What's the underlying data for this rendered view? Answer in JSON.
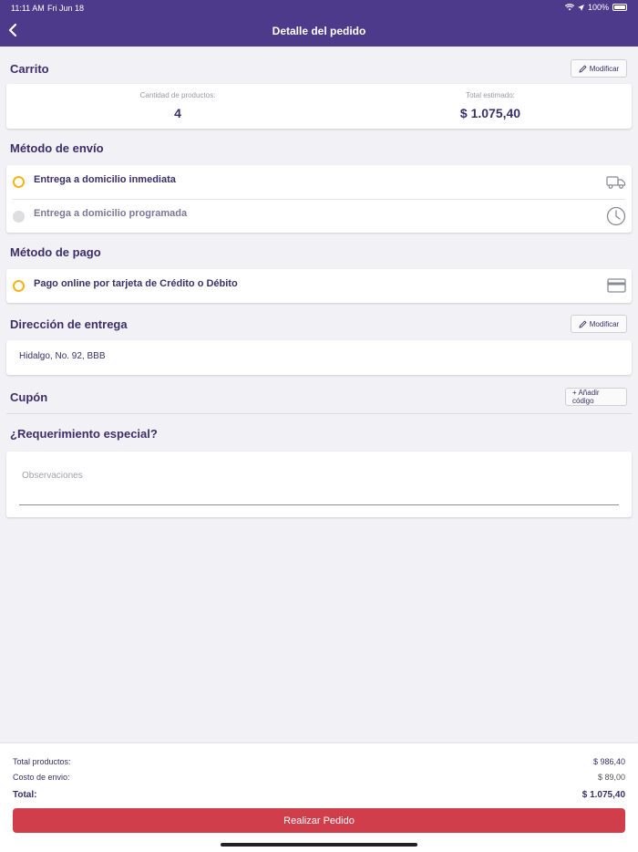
{
  "status": {
    "time": "11:11 AM",
    "date": "Fri Jun 18",
    "battery": "100%"
  },
  "header": {
    "title": "Detalle del pedido"
  },
  "cart": {
    "title": "Carrito",
    "modify_label": "Modificar",
    "qty_label": "Cantidad de productos:",
    "qty_value": "4",
    "total_label": "Total estimado:",
    "total_value": "$ 1.075,40"
  },
  "shipping": {
    "title": "Método de envío",
    "options": [
      {
        "label": "Entrega a domicilio inmediata",
        "selected": true,
        "icon": "truck-icon"
      },
      {
        "label": "Entrega a domicilio programada",
        "selected": false,
        "icon": "clock-icon"
      }
    ]
  },
  "payment": {
    "title": "Método de pago",
    "options": [
      {
        "label": "Pago online por tarjeta de Crédito o Débito",
        "selected": true,
        "icon": "credit-card-icon"
      }
    ]
  },
  "address": {
    "title": "Dirección de entrega",
    "modify_label": "Modificar",
    "value": "Hidalgo, No. 92, BBB"
  },
  "coupon": {
    "title": "Cupón",
    "add_label": "+ Añadir código"
  },
  "special": {
    "title": "¿Requerimiento especial?",
    "placeholder": "Observaciones"
  },
  "summary": {
    "products_label": "Total productos:",
    "products_value": "$ 986,40",
    "shipping_label": "Costo de envio:",
    "shipping_value": "$ 89,00",
    "total_label": "Total:",
    "total_value": "$ 1.075,40",
    "cta_label": "Realizar Pedido"
  },
  "colors": {
    "header": "#4e3a8a",
    "accent": "#f3b416",
    "cta": "#cf3e4a",
    "text": "#3b2f6b"
  }
}
